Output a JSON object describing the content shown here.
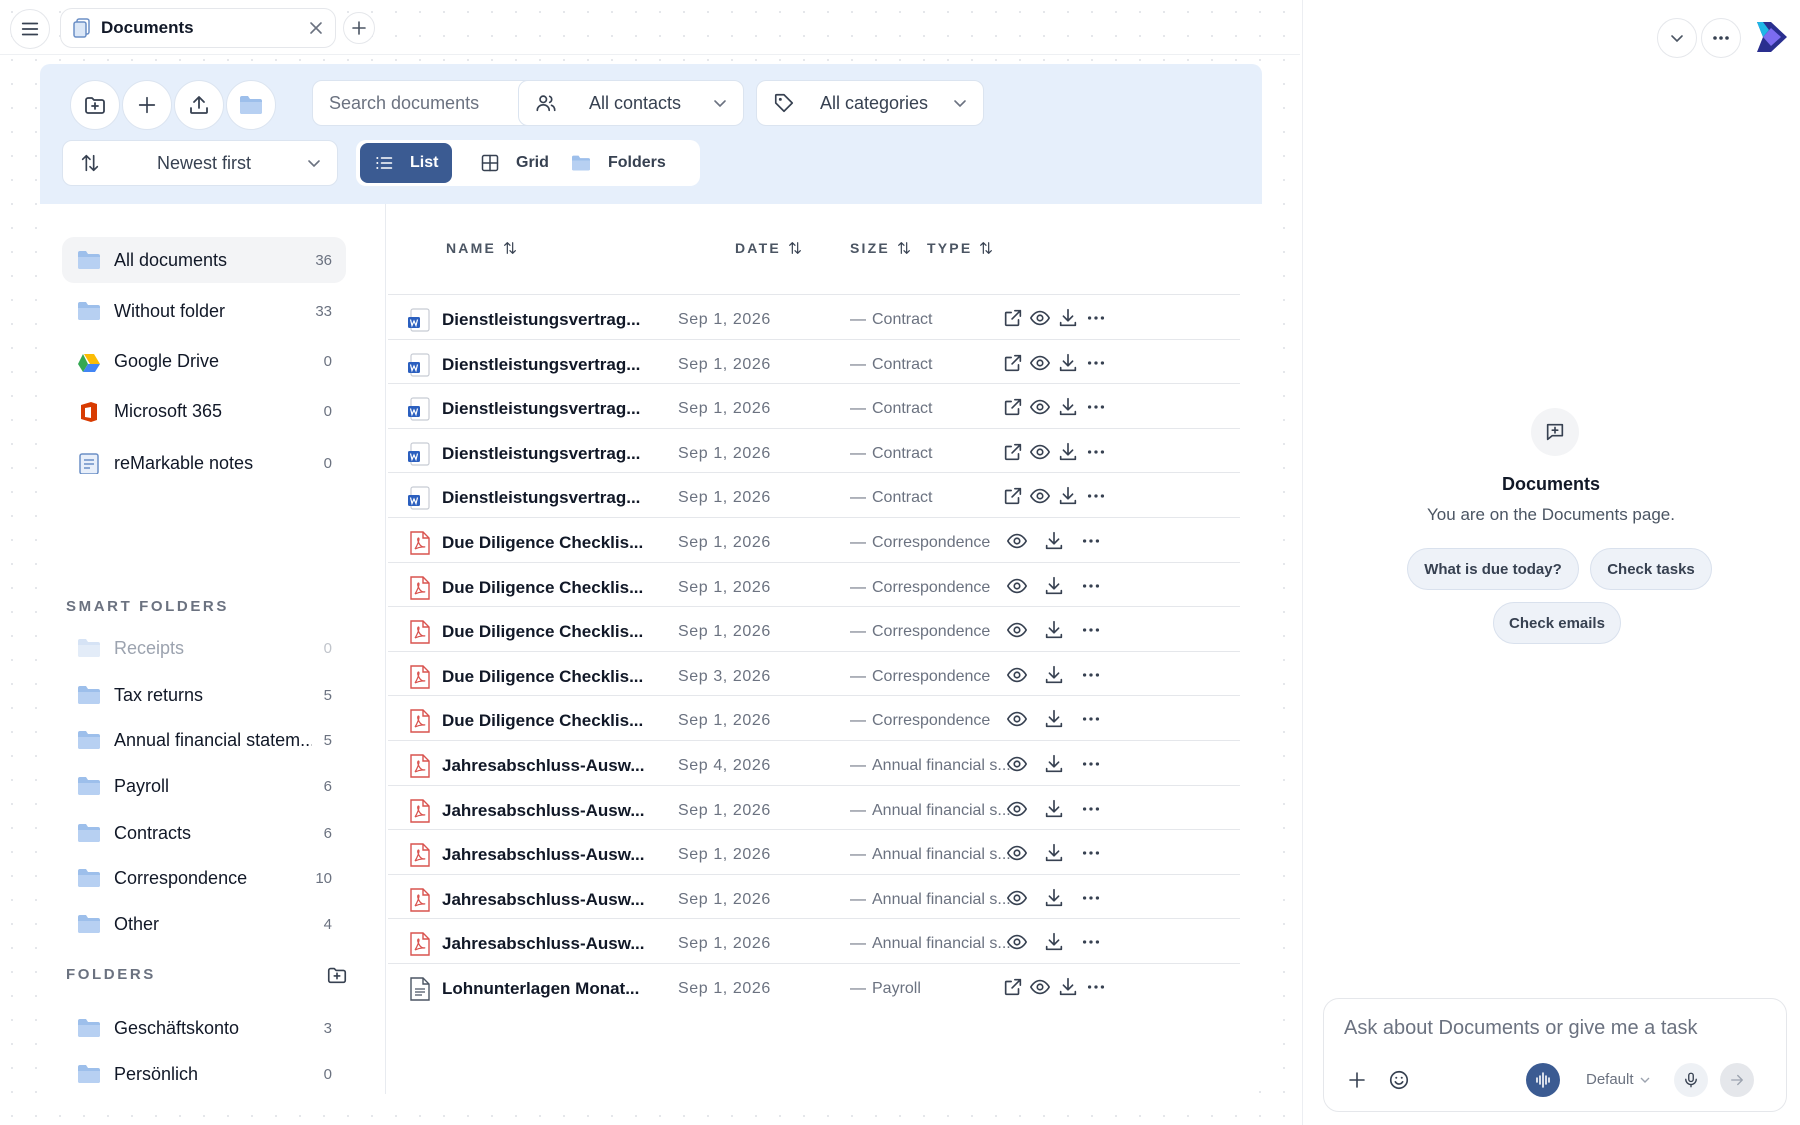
{
  "tab": {
    "title": "Documents"
  },
  "toolbar": {
    "search_placeholder": "Search documents",
    "contacts_filter": "All contacts",
    "categories_filter": "All categories",
    "sort": "Newest first",
    "views": {
      "list": "List",
      "grid": "Grid",
      "folders": "Folders",
      "active": "list"
    }
  },
  "nav": {
    "items": [
      {
        "label": "All documents",
        "count": "36"
      },
      {
        "label": "Without folder",
        "count": "33"
      },
      {
        "label": "Google Drive",
        "count": "0"
      },
      {
        "label": "Microsoft 365",
        "count": "0"
      },
      {
        "label": "reMarkable notes",
        "count": "0"
      }
    ],
    "smart_title": "SMART FOLDERS",
    "smart": [
      {
        "label": "Receipts",
        "count": "0"
      },
      {
        "label": "Tax returns",
        "count": "5"
      },
      {
        "label": "Annual financial statem...",
        "count": "5"
      },
      {
        "label": "Payroll",
        "count": "6"
      },
      {
        "label": "Contracts",
        "count": "6"
      },
      {
        "label": "Correspondence",
        "count": "10"
      },
      {
        "label": "Other",
        "count": "4"
      }
    ],
    "folders_title": "FOLDERS",
    "folders": [
      {
        "label": "Geschäftskonto",
        "count": "3"
      },
      {
        "label": "Persönlich",
        "count": "0"
      }
    ]
  },
  "table": {
    "headers": {
      "name": "NAME",
      "date": "DATE",
      "size": "SIZE",
      "type": "TYPE"
    },
    "rows": [
      {
        "name": "Dienstleistungsvertrag...",
        "date": "Sep 1, 2026",
        "size": "—",
        "type": "Contract",
        "file": "word"
      },
      {
        "name": "Dienstleistungsvertrag...",
        "date": "Sep 1, 2026",
        "size": "—",
        "type": "Contract",
        "file": "word"
      },
      {
        "name": "Dienstleistungsvertrag...",
        "date": "Sep 1, 2026",
        "size": "—",
        "type": "Contract",
        "file": "word"
      },
      {
        "name": "Dienstleistungsvertrag...",
        "date": "Sep 1, 2026",
        "size": "—",
        "type": "Contract",
        "file": "word"
      },
      {
        "name": "Dienstleistungsvertrag...",
        "date": "Sep 1, 2026",
        "size": "—",
        "type": "Contract",
        "file": "word"
      },
      {
        "name": "Due Diligence Checklis...",
        "date": "Sep 1, 2026",
        "size": "—",
        "type": "Correspondence",
        "file": "pdf"
      },
      {
        "name": "Due Diligence Checklis...",
        "date": "Sep 1, 2026",
        "size": "—",
        "type": "Correspondence",
        "file": "pdf"
      },
      {
        "name": "Due Diligence Checklis...",
        "date": "Sep 1, 2026",
        "size": "—",
        "type": "Correspondence",
        "file": "pdf"
      },
      {
        "name": "Due Diligence Checklis...",
        "date": "Sep 3, 2026",
        "size": "—",
        "type": "Correspondence",
        "file": "pdf"
      },
      {
        "name": "Due Diligence Checklis...",
        "date": "Sep 1, 2026",
        "size": "—",
        "type": "Correspondence",
        "file": "pdf"
      },
      {
        "name": "Jahresabschluss-Ausw...",
        "date": "Sep 4, 2026",
        "size": "—",
        "type": "Annual financial s...",
        "file": "pdf"
      },
      {
        "name": "Jahresabschluss-Ausw...",
        "date": "Sep 1, 2026",
        "size": "—",
        "type": "Annual financial s...",
        "file": "pdf"
      },
      {
        "name": "Jahresabschluss-Ausw...",
        "date": "Sep 1, 2026",
        "size": "—",
        "type": "Annual financial s...",
        "file": "pdf"
      },
      {
        "name": "Jahresabschluss-Ausw...",
        "date": "Sep 1, 2026",
        "size": "—",
        "type": "Annual financial s...",
        "file": "pdf"
      },
      {
        "name": "Jahresabschluss-Ausw...",
        "date": "Sep 1, 2026",
        "size": "—",
        "type": "Annual financial s...",
        "file": "pdf"
      },
      {
        "name": "Lohnunterlagen Monat...",
        "date": "Sep 1, 2026",
        "size": "—",
        "type": "Payroll",
        "file": "text"
      }
    ]
  },
  "assistant": {
    "title": "Documents",
    "subtitle": "You are on the Documents page.",
    "suggestions": [
      "What is due today?",
      "Check tasks",
      "Check emails"
    ],
    "input_placeholder": "Ask about Documents or give me a task",
    "model": "Default"
  },
  "colors": {
    "accent": "#3b5b92",
    "toolbar_bg": "#e6effb",
    "pdf_red": "#d9534f",
    "word_blue": "#2b5fbf",
    "folder_blue": "#8fb4e6"
  }
}
